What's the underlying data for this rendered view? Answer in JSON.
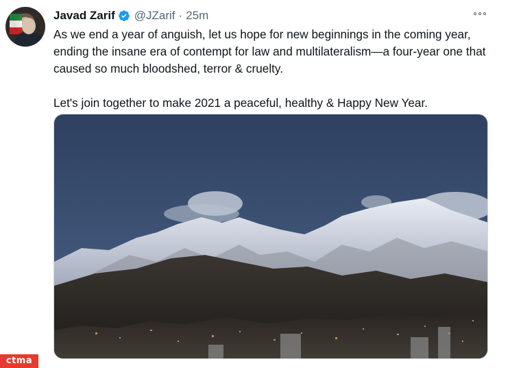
{
  "tweet": {
    "author_name": "Javad Zarif",
    "handle": "@JZarif",
    "separator": "·",
    "time": "25m",
    "paragraph_1": "As we end a year of anguish, let us hope for new beginnings in the coming year, ending the insane era of contempt for law and multilateralism—a four-year one that caused so much bloodshed, terror & cruelty.",
    "paragraph_2": "Let's join together to make 2021 a peaceful, healthy & Happy New Year."
  },
  "watermark": {
    "text": "ctma"
  },
  "colors": {
    "verified_badge": "#1d9bf0",
    "secondary_text": "#536471",
    "watermark_bg": "#e63b2e"
  },
  "icons": {
    "verified": "verified-badge-icon",
    "more": "more-options-icon"
  }
}
